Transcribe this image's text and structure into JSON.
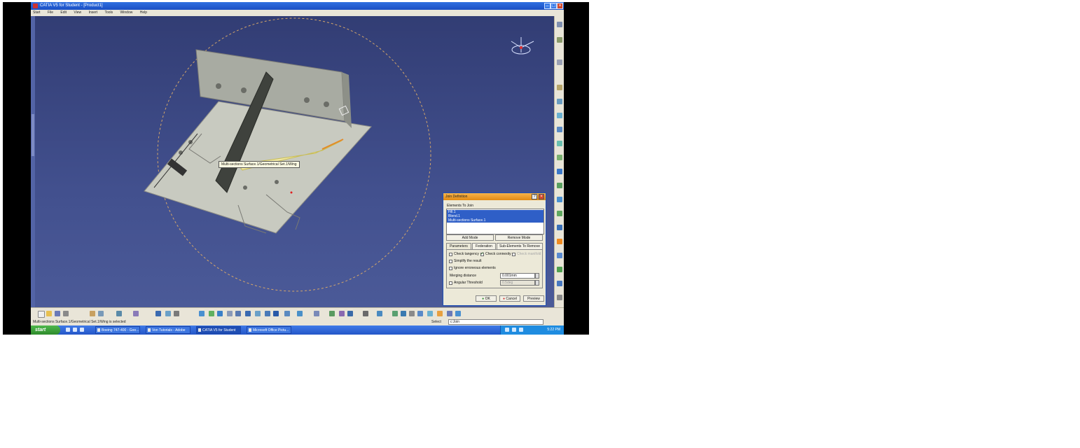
{
  "window": {
    "title": "CATIA V5 for Student - [Product1]"
  },
  "menu": [
    "Start",
    "File",
    "Edit",
    "View",
    "Insert",
    "Tools",
    "Window",
    "Help"
  ],
  "viewport": {
    "tooltip": "Multi-sections Surface.1/Geometrical Set.1/Wing"
  },
  "dialog": {
    "title": "Join Definition",
    "elements_label": "Elements To Join",
    "elements": [
      "Fill.1",
      "Blend.1",
      "Multi-sections Surface.1"
    ],
    "add_mode": "Add Mode",
    "remove_mode": "Remove Mode",
    "tabs": [
      "Parameters",
      "Federation",
      "Sub-Elements To Remove"
    ],
    "check_tangency": "Check tangency",
    "check_connexity": "Check connexity",
    "check_manifold": "Check manifold",
    "simplify": "Simplify the result",
    "ignore": "Ignore erroneous elements",
    "merging_label": "Merging distance",
    "merging_value": "0.001mm",
    "angular_label": "Angular Threshold",
    "angular_value": "0.5deg",
    "ok": "OK",
    "cancel": "Cancel",
    "preview": "Preview"
  },
  "statusbar": {
    "message": "Multi-sections Surface.1/Geometrical Set.1/Wing is selected",
    "command_label": "Select",
    "command_value": "c:Join"
  },
  "taskbar": {
    "start": "start",
    "tasks": [
      "Boeing 747-400 - Goo...",
      "Von Tutorials - Adobe",
      "CATIA V5 for Student",
      "Microsoft Office Pictu..."
    ],
    "clock": "5:22 PM"
  },
  "colors": {
    "viewport": "#3a4780",
    "titlebar": "#1b4fc4",
    "dialog_title": "#e28a14",
    "selection": "#2f5fc7"
  }
}
